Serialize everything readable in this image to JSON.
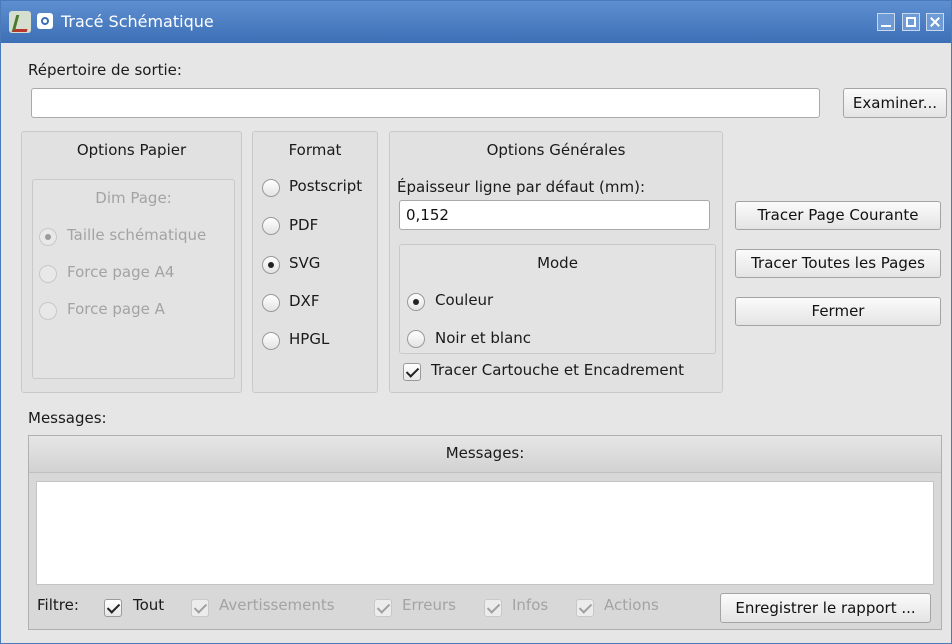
{
  "window": {
    "title": "Tracé Schématique"
  },
  "output_dir": {
    "label": "Répertoire de sortie:",
    "value": "",
    "browse_button": "Examiner..."
  },
  "paper": {
    "title": "Options Papier",
    "dim_page": {
      "title": "Dim Page:",
      "options": [
        "Taille schématique",
        "Force page A4",
        "Force page A"
      ],
      "selected": "Taille schématique"
    }
  },
  "format": {
    "title": "Format",
    "options": [
      "Postscript",
      "PDF",
      "SVG",
      "DXF",
      "HPGL"
    ],
    "selected": "SVG"
  },
  "general": {
    "title": "Options Générales",
    "line_width_label": "Épaisseur ligne par défaut (mm):",
    "line_width_value": "0,152",
    "mode": {
      "title": "Mode",
      "options": [
        "Couleur",
        "Noir et blanc"
      ],
      "selected": "Couleur"
    },
    "frame_checkbox": {
      "label": "Tracer Cartouche et Encadrement",
      "checked": true
    }
  },
  "actions": {
    "plot_current": "Tracer Page Courante",
    "plot_all": "Tracer Toutes les Pages",
    "close": "Fermer"
  },
  "messages": {
    "label": "Messages:",
    "header": "Messages:",
    "content": "",
    "filter_label": "Filtre:",
    "filters": [
      {
        "label": "Tout",
        "checked": true,
        "enabled": true
      },
      {
        "label": "Avertissements",
        "checked": true,
        "enabled": false
      },
      {
        "label": "Erreurs",
        "checked": true,
        "enabled": false
      },
      {
        "label": "Infos",
        "checked": true,
        "enabled": false
      },
      {
        "label": "Actions",
        "checked": true,
        "enabled": false
      }
    ],
    "save_button": "Enregistrer le rapport ..."
  }
}
